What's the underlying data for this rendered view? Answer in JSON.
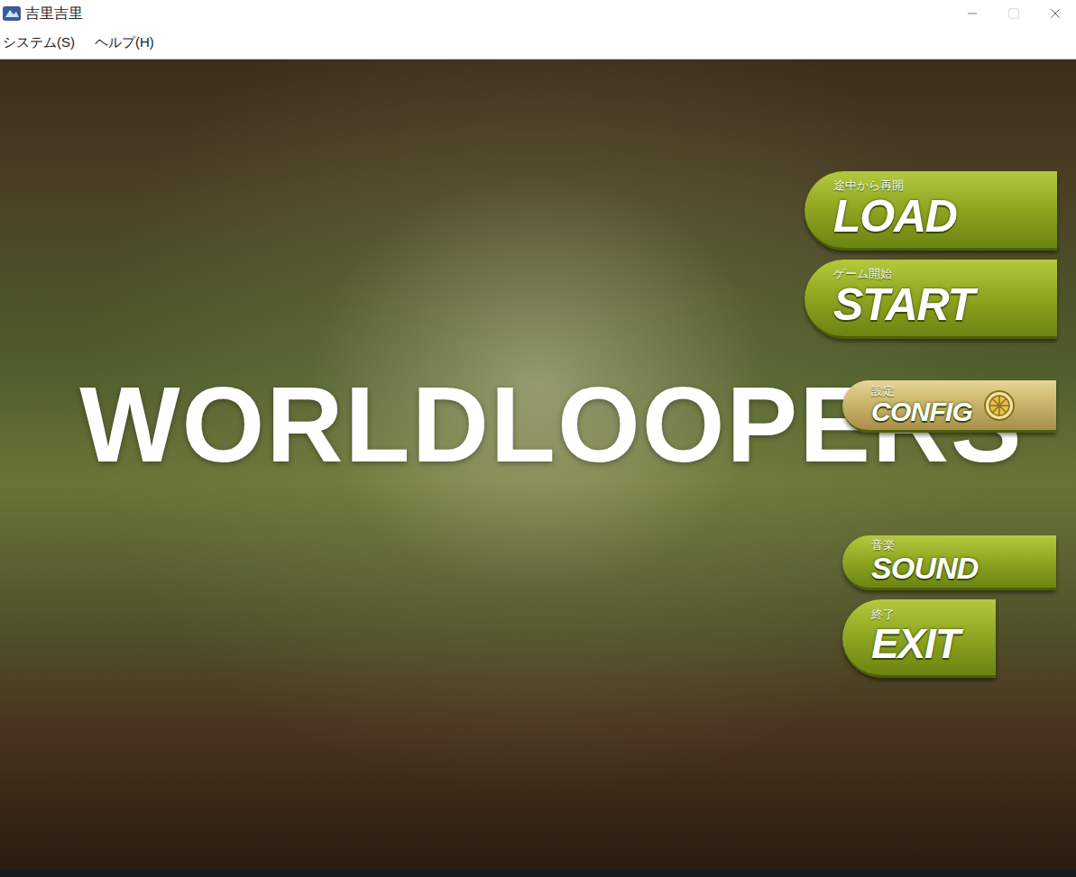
{
  "window": {
    "title": "吉里吉里"
  },
  "menu": [
    "システム(S)",
    "ヘルプ(H)"
  ],
  "game": {
    "title": "WORLDLOOPERS",
    "buttons": [
      {
        "label": "LOAD",
        "caption": "途中から再開",
        "kind": "large"
      },
      {
        "label": "START",
        "caption": "ゲーム開始",
        "kind": "large"
      },
      {
        "label": "CONFIG",
        "caption": "設定",
        "kind": "config"
      },
      {
        "label": "SOUND",
        "caption": "音楽",
        "kind": "small"
      },
      {
        "label": "EXIT",
        "caption": "終了",
        "kind": "short"
      }
    ]
  }
}
